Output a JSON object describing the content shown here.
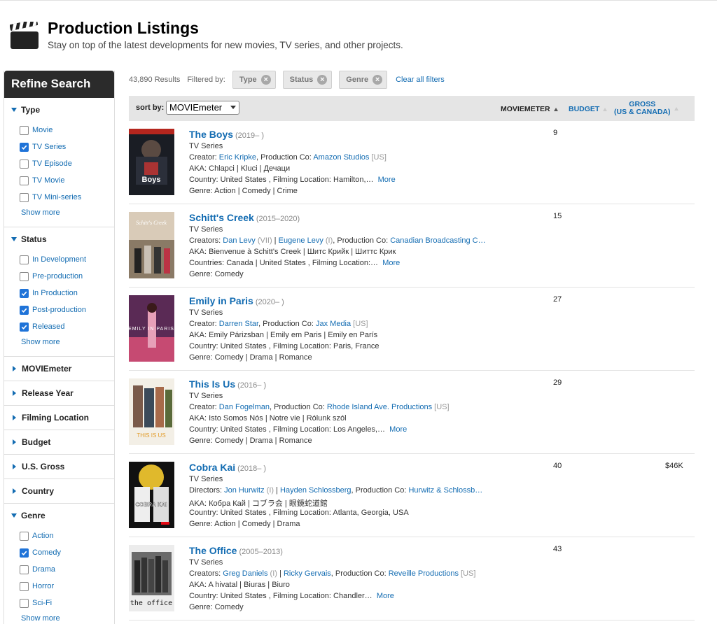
{
  "header": {
    "title": "Production Listings",
    "subtitle": "Stay on top of the latest developments for new movies, TV series, and other projects."
  },
  "sidebar": {
    "heading": "Refine Search",
    "type": {
      "title": "Type",
      "items": [
        {
          "label": "Movie",
          "checked": false
        },
        {
          "label": "TV Series",
          "checked": true
        },
        {
          "label": "TV Episode",
          "checked": false
        },
        {
          "label": "TV Movie",
          "checked": false
        },
        {
          "label": "TV Mini-series",
          "checked": false
        }
      ],
      "show_more": "Show more"
    },
    "status": {
      "title": "Status",
      "items": [
        {
          "label": "In Development",
          "checked": false
        },
        {
          "label": "Pre-production",
          "checked": false
        },
        {
          "label": "In Production",
          "checked": true
        },
        {
          "label": "Post-production",
          "checked": true
        },
        {
          "label": "Released",
          "checked": true
        }
      ],
      "show_more": "Show more"
    },
    "collapsed": [
      "MOVIEmeter",
      "Release Year",
      "Filming Location",
      "Budget",
      "U.S. Gross",
      "Country"
    ],
    "genre": {
      "title": "Genre",
      "items": [
        {
          "label": "Action",
          "checked": false
        },
        {
          "label": "Comedy",
          "checked": true
        },
        {
          "label": "Drama",
          "checked": false
        },
        {
          "label": "Horror",
          "checked": false
        },
        {
          "label": "Sci-Fi",
          "checked": false
        }
      ],
      "show_more": "Show more"
    }
  },
  "filters": {
    "results_count": "43,890 Results",
    "filtered_by": "Filtered by:",
    "chips": [
      "Type",
      "Status",
      "Genre"
    ],
    "clear_all": "Clear all filters"
  },
  "sort": {
    "label": "sort by:",
    "selected": "MOVIEmeter",
    "columns": {
      "moviemeter": "MOVIEMETER",
      "budget": "BUDGET",
      "gross_line1": "GROSS",
      "gross_line2": "(US & CANADA)"
    }
  },
  "colors": {
    "link": "#136cb2",
    "checkbox": "#1f73d8",
    "sidebar_header": "#2b2b2b"
  },
  "results": [
    {
      "title": "The Boys",
      "years": "(2019– )",
      "type": "TV Series",
      "line1_label": "Creator: ",
      "line1_link1": "Eric Kripke",
      "line1_link1_suffix": "",
      "line1_link2": "",
      "line1_link2_suffix": "",
      "line1_pc_label": ", Production Co: ",
      "line1_pc": "Amazon Studios",
      "line1_pc_suffix": " [US]",
      "aka": "AKA: Chlapci | Kluci | Дечаци",
      "country": "Country: United States , Filming Location: Hamilton,…",
      "more": "More",
      "genre": "Genre: Action | Comedy | Crime",
      "meter": "9",
      "gross": ""
    },
    {
      "title": "Schitt's Creek",
      "years": "(2015–2020)",
      "type": "TV Series",
      "line1_label": "Creators: ",
      "line1_link1": "Dan Levy",
      "line1_link1_suffix": " (VII)",
      "line1_link2": "Eugene Levy",
      "line1_link2_suffix": " (I)",
      "line1_pc_label": ", Production Co: ",
      "line1_pc": "Canadian Broadcasting C…",
      "line1_pc_suffix": "",
      "aka": "AKA: Bienvenue à Schitt's Creek | Шитс Крийк | Шиттс Крик",
      "country": "Countries: Canada | United States , Filming Location:…",
      "more": "More",
      "genre": "Genre: Comedy",
      "meter": "15",
      "gross": ""
    },
    {
      "title": "Emily in Paris",
      "years": "(2020– )",
      "type": "TV Series",
      "line1_label": "Creator: ",
      "line1_link1": "Darren Star",
      "line1_link1_suffix": "",
      "line1_link2": "",
      "line1_link2_suffix": "",
      "line1_pc_label": ", Production Co: ",
      "line1_pc": "Jax Media",
      "line1_pc_suffix": " [US]",
      "aka": "AKA: Emily Párizsban | Emily em Paris | Emily en París",
      "country": "Country: United States , Filming Location: Paris, France",
      "more": "",
      "genre": "Genre: Comedy | Drama | Romance",
      "meter": "27",
      "gross": ""
    },
    {
      "title": "This Is Us",
      "years": "(2016– )",
      "type": "TV Series",
      "line1_label": "Creator: ",
      "line1_link1": "Dan Fogelman",
      "line1_link1_suffix": "",
      "line1_link2": "",
      "line1_link2_suffix": "",
      "line1_pc_label": ", Production Co: ",
      "line1_pc": "Rhode Island Ave. Productions",
      "line1_pc_suffix": " [US]",
      "aka": "AKA: Isto Somos Nós | Notre vie | Rólunk szól",
      "country": "Country: United States , Filming Location: Los Angeles,…",
      "more": "More",
      "genre": "Genre: Comedy | Drama | Romance",
      "meter": "29",
      "gross": ""
    },
    {
      "title": "Cobra Kai",
      "years": "(2018– )",
      "type": "TV Series",
      "line1_label": "Directors: ",
      "line1_link1": "Jon Hurwitz",
      "line1_link1_suffix": " (I)",
      "line1_link2": "Hayden Schlossberg",
      "line1_link2_suffix": "",
      "line1_pc_label": ", Production Co: ",
      "line1_pc": "Hurwitz & Schlossb…",
      "line1_pc_suffix": "",
      "aka": "AKA: Кобра Кай | コブラ会 | 眼鏡蛇道館",
      "country": "Country: United States , Filming Location: Atlanta, Georgia, USA",
      "more": "",
      "genre": "Genre: Action | Comedy | Drama",
      "meter": "40",
      "gross": "$46K"
    },
    {
      "title": "The Office",
      "years": "(2005–2013)",
      "type": "TV Series",
      "line1_label": "Creators: ",
      "line1_link1": "Greg Daniels",
      "line1_link1_suffix": " (I)",
      "line1_link2": "Ricky Gervais",
      "line1_link2_suffix": "",
      "line1_pc_label": ", Production Co: ",
      "line1_pc": "Reveille Productions",
      "line1_pc_suffix": " [US]",
      "aka": "AKA: A hivatal | Biuras | Biuro",
      "country": "Country: United States , Filming Location: Chandler…",
      "more": "More",
      "genre": "Genre: Comedy",
      "meter": "43",
      "gross": ""
    }
  ],
  "posters": [
    {
      "text": "Boys"
    },
    {
      "text": "Schitt's Creek"
    },
    {
      "text": "EMILY IN PARIS"
    },
    {
      "text": "THIS IS US"
    },
    {
      "text": "COBRA KAI"
    },
    {
      "text": "the office"
    }
  ]
}
